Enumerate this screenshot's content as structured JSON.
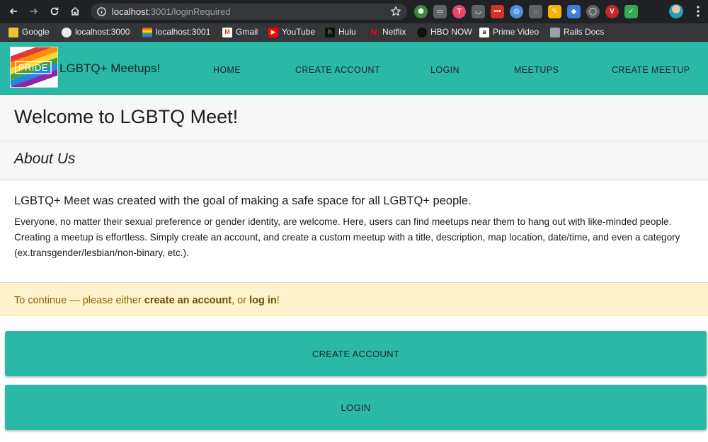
{
  "browser": {
    "url_host": "localhost",
    "url_path": ":3001/loginRequired",
    "bookmarks": [
      {
        "label": "Google"
      },
      {
        "label": "localhost:3000"
      },
      {
        "label": "localhost:3001"
      },
      {
        "label": "Gmail"
      },
      {
        "label": "YouTube"
      },
      {
        "label": "Hulu"
      },
      {
        "label": "Netflix"
      },
      {
        "label": "HBO NOW"
      },
      {
        "label": "Prime Video"
      },
      {
        "label": "Rails Docs"
      }
    ],
    "icons": [
      "back-icon",
      "forward-icon",
      "reload-icon",
      "home-icon",
      "info-icon",
      "star-icon",
      "menu-icon"
    ]
  },
  "site": {
    "logo_text": "PRIDE",
    "brand": "LGBTQ+ Meetups!",
    "nav": [
      {
        "label": "HOME"
      },
      {
        "label": "CREATE ACCOUNT"
      },
      {
        "label": "LOGIN"
      },
      {
        "label": "MEETUPS"
      },
      {
        "label": "CREATE MEETUP"
      }
    ],
    "accent_color": "#2ab8a7"
  },
  "hero": {
    "title": "Welcome to LGBTQ Meet!"
  },
  "about": {
    "heading": "About Us",
    "lead": "LGBTQ+ Meet was created with the goal of making a safe space for all LGBTQ+ people.",
    "body": "Everyone, no matter their sexual preference or gender identity, are welcome. Here, users can find meetups near them to hang out with like-minded people. Creating a meetup is effortless. Simply create an account, and create a custom meetup with a title, description, map location, date/time, and even a category (ex.transgender/lesbian/non-binary, etc.)."
  },
  "alert": {
    "prefix": "To continue — please either ",
    "create_link": "create an account",
    "middle": ", or ",
    "login_link": "log in",
    "suffix": "!"
  },
  "actions": {
    "create_label": "CREATE ACCOUNT",
    "login_label": "LOGIN"
  }
}
